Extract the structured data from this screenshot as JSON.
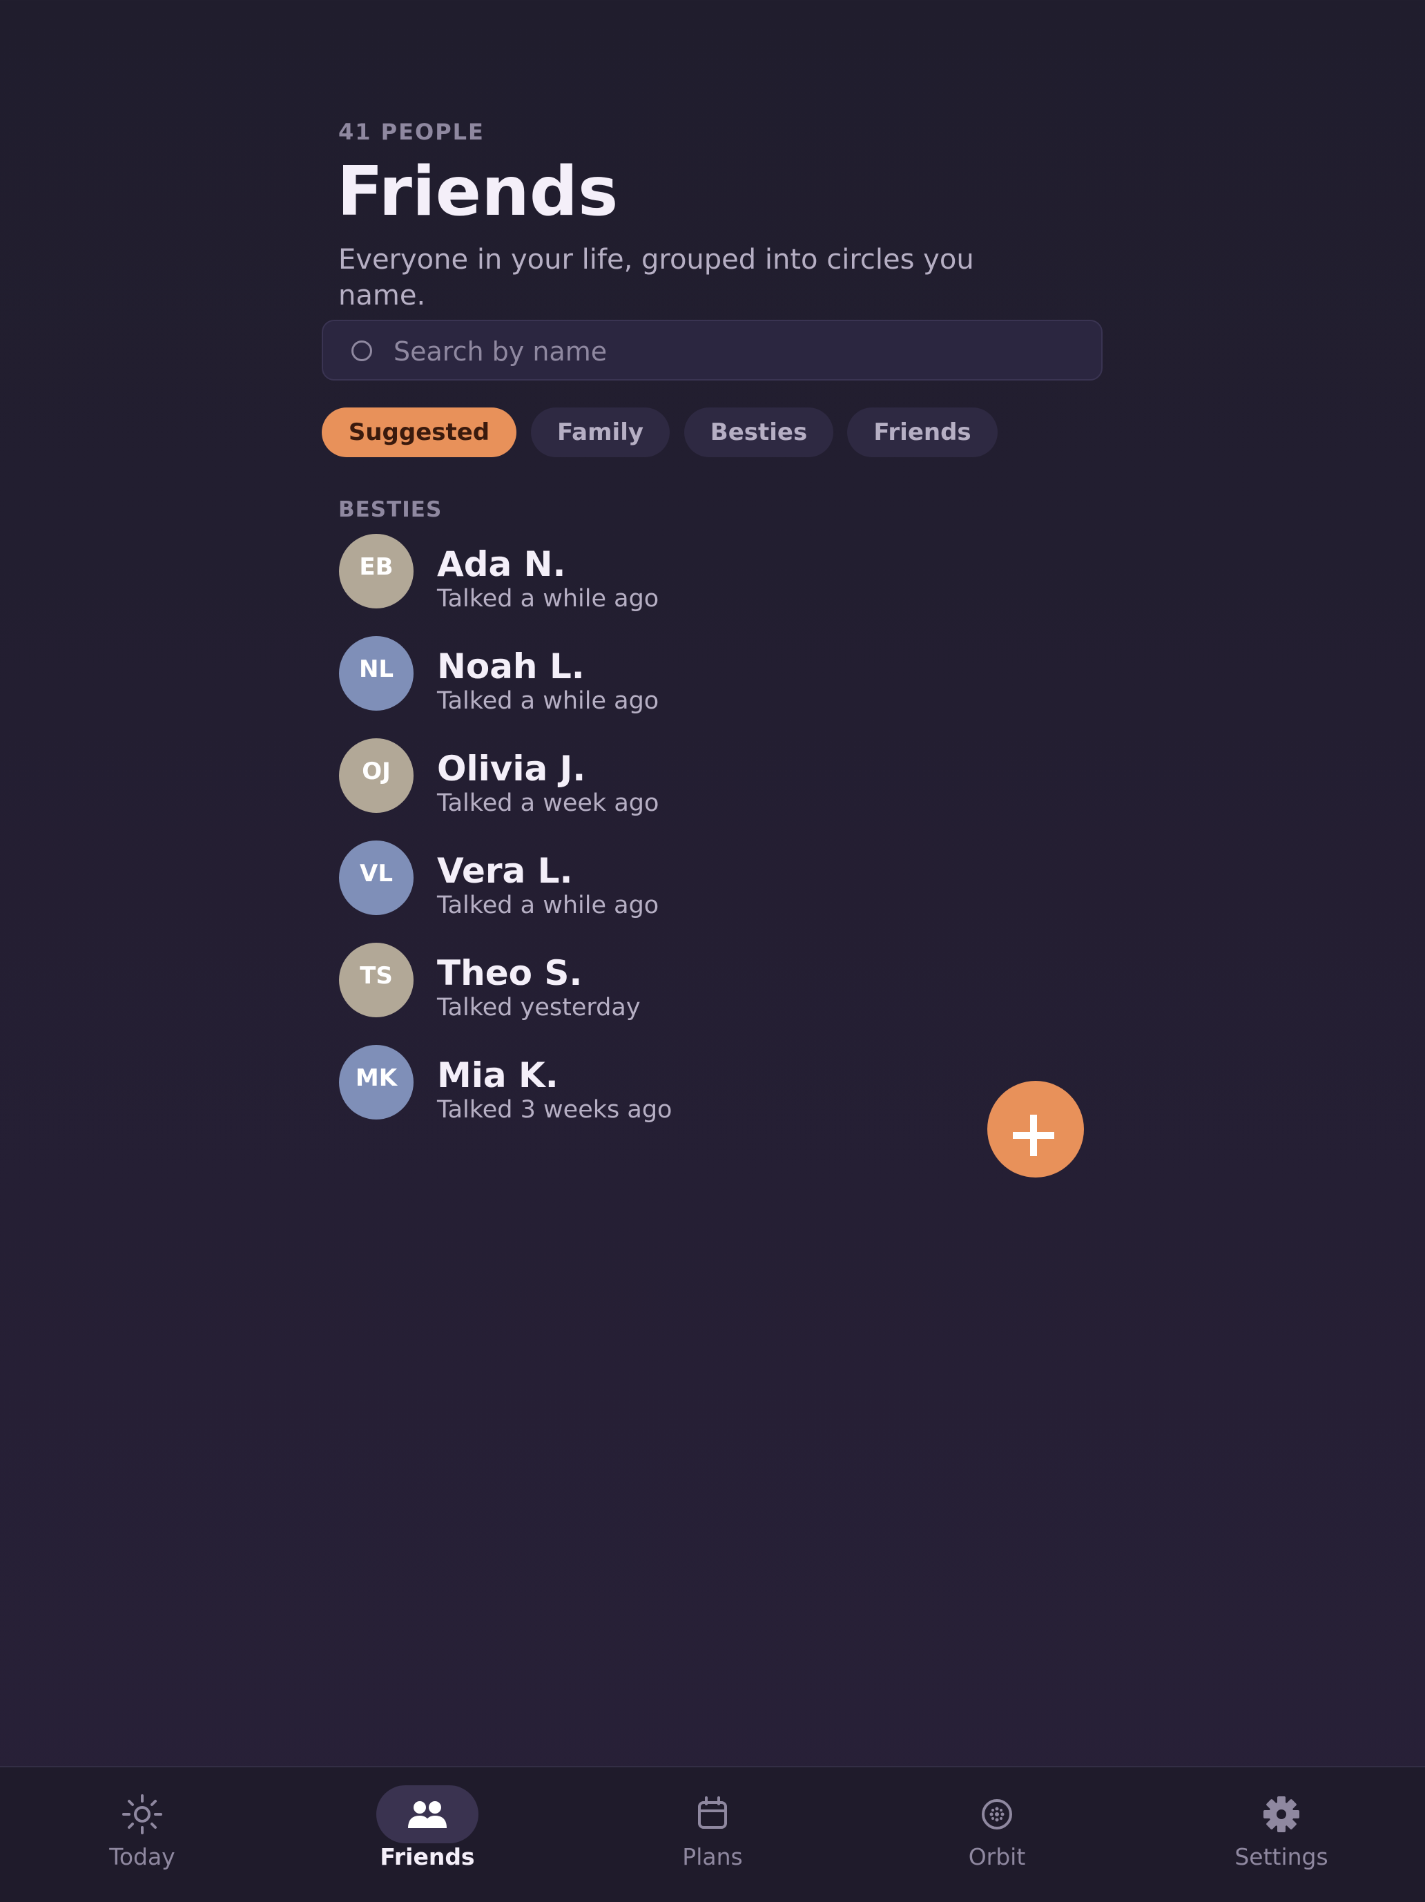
{
  "header": {
    "count": "41 PEOPLE",
    "title": "Friends",
    "subtitle": "Everyone in your life, grouped into circles you name."
  },
  "search": {
    "placeholder": "Search by name",
    "value": "",
    "icon": "search-icon"
  },
  "filters": [
    {
      "label": "Suggested",
      "active": true
    },
    {
      "label": "Family",
      "active": false
    },
    {
      "label": "Besties",
      "active": false
    },
    {
      "label": "Friends",
      "active": false
    }
  ],
  "section": {
    "label": "BESTIES"
  },
  "friends": [
    {
      "initials": "EB",
      "name": "Ada N.",
      "status": "Talked a while ago",
      "avatar_color": "#b2a897"
    },
    {
      "initials": "NL",
      "name": "Noah L.",
      "status": "Talked a while ago",
      "avatar_color": "#7f8fb8"
    },
    {
      "initials": "OJ",
      "name": "Olivia J.",
      "status": "Talked a week ago",
      "avatar_color": "#b2a897"
    },
    {
      "initials": "VL",
      "name": "Vera L.",
      "status": "Talked a while ago",
      "avatar_color": "#7f8fb8"
    },
    {
      "initials": "TS",
      "name": "Theo S.",
      "status": "Talked yesterday",
      "avatar_color": "#b2a897"
    },
    {
      "initials": "MK",
      "name": "Mia K.",
      "status": "Talked 3 weeks ago",
      "avatar_color": "#7f8fb8"
    }
  ],
  "fab": {
    "icon": "plus-icon",
    "color": "#e8915a"
  },
  "nav": [
    {
      "label": "Today",
      "icon": "sun-icon",
      "active": false
    },
    {
      "label": "Friends",
      "icon": "people-icon",
      "active": true
    },
    {
      "label": "Plans",
      "icon": "calendar-icon",
      "active": false
    },
    {
      "label": "Orbit",
      "icon": "orbit-icon",
      "active": false
    },
    {
      "label": "Settings",
      "icon": "gear-icon",
      "active": false
    }
  ],
  "colors": {
    "accent": "#e8915a",
    "background": "#201d2d",
    "muted_text": "#8f88a0",
    "secondary_text": "#b6afc4"
  }
}
